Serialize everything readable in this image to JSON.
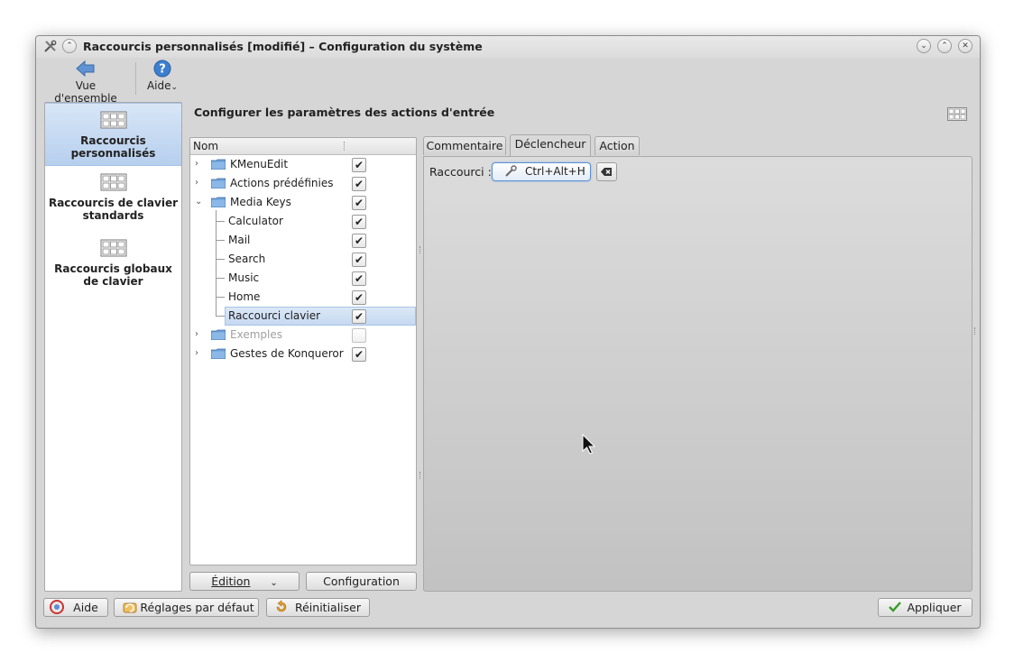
{
  "window": {
    "title": "Raccourcis personnalisés [modifié] – Configuration du système"
  },
  "toolbar": {
    "overview_label": "Vue d'ensemble",
    "help_label": "Aide"
  },
  "sidebar": {
    "items": [
      {
        "label": "Raccourcis personnalisés",
        "selected": true,
        "icon": "keyboard-icon"
      },
      {
        "label": "Raccourcis de clavier standards",
        "selected": false,
        "icon": "keyboard-icon"
      },
      {
        "label": "Raccourcis globaux de clavier",
        "selected": false,
        "icon": "keyboard-icon"
      }
    ]
  },
  "main": {
    "section_title": "Configurer les paramètres des actions d'entrée",
    "tree": {
      "column_header": "Nom",
      "rows": [
        {
          "label": "KMenuEdit",
          "type": "folder",
          "checked": true
        },
        {
          "label": "Actions prédéfinies",
          "type": "folder",
          "checked": true
        },
        {
          "label": "Media Keys",
          "type": "folder",
          "checked": true,
          "expanded": true
        },
        {
          "label": "Calculator",
          "type": "item",
          "checked": true
        },
        {
          "label": "Mail",
          "type": "item",
          "checked": true
        },
        {
          "label": "Search",
          "type": "item",
          "checked": true
        },
        {
          "label": "Music",
          "type": "item",
          "checked": true
        },
        {
          "label": "Home",
          "type": "item",
          "checked": true
        },
        {
          "label": "Raccourci clavier",
          "type": "item",
          "checked": true,
          "selected": true
        },
        {
          "label": "Exemples",
          "type": "folder",
          "checked": false,
          "disabled": true
        },
        {
          "label": "Gestes de Konqueror",
          "type": "folder",
          "checked": true
        }
      ],
      "edit_button": "Édition",
      "config_button": "Configuration"
    },
    "tabs": [
      {
        "label": "Commentaire",
        "active": false
      },
      {
        "label": "Déclencheur",
        "active": true
      },
      {
        "label": "Action",
        "active": false
      }
    ],
    "trigger": {
      "shortcut_label": "Raccourci :",
      "shortcut_value": "Ctrl+Alt+H"
    }
  },
  "footer": {
    "help": "Aide",
    "defaults": "Réglages par défaut",
    "reset": "Réinitialiser",
    "apply": "Appliquer"
  },
  "colors": {
    "selection": "#c5d9f1",
    "window_bg": "#d6d6d6",
    "accent_blue": "#3c7fd0"
  }
}
